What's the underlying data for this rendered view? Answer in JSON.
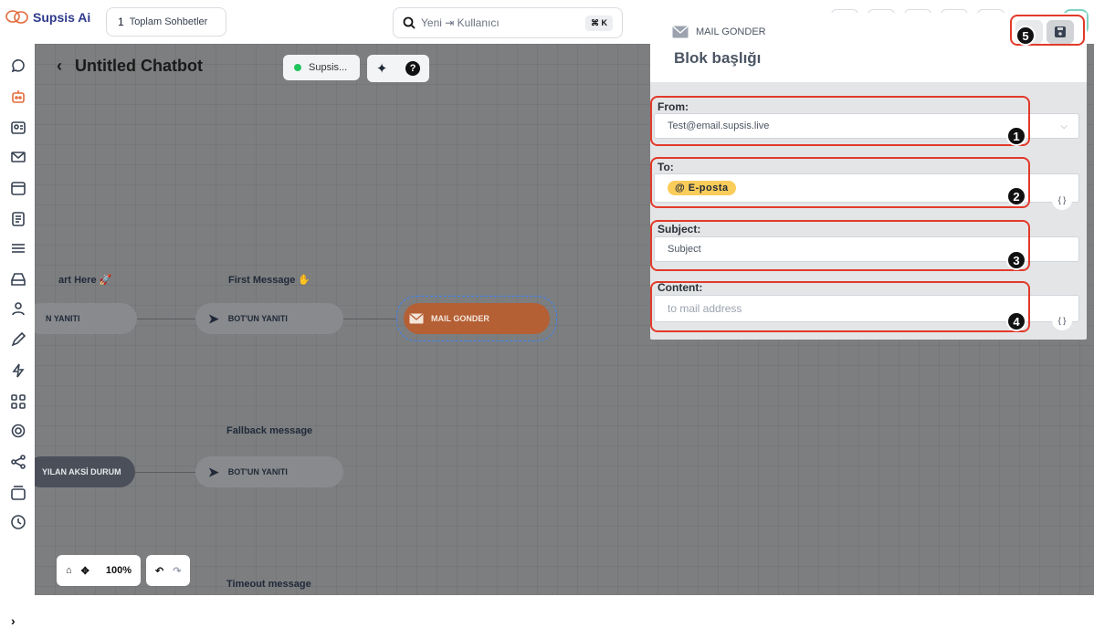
{
  "app": {
    "name": "Supsis Ai"
  },
  "topbar": {
    "total_count": "1",
    "total_label": "Toplam Sohbetler",
    "search_text": "Yeni ⇥ Kullanıcı",
    "shortcut": "⌘ K"
  },
  "canvas": {
    "chatbot_title": "Untitled Chatbot",
    "status_label": "Supsis...",
    "labels": {
      "start": "art Here 🚀",
      "first": "First Message ✋",
      "fallback": "Fallback message",
      "timeout": "Timeout message"
    },
    "nodes": {
      "start_node": "N YANITI",
      "bot_reply_1": "BOT'UN YANITI",
      "mail_send": "MAIL GONDER",
      "default_case": "YILAN AKSİ DURUM",
      "bot_reply_2": "BOT'UN YANITI"
    },
    "zoom": "100%"
  },
  "panel": {
    "type_label": "MAIL GONDER",
    "block_title": "Blok başlığı",
    "from": {
      "label": "From:",
      "value": "Test@email.supsis.live"
    },
    "to": {
      "label": "To:",
      "tag": "E-posta",
      "tag_symbol": "@"
    },
    "subject": {
      "label": "Subject:",
      "value": "Subject"
    },
    "content": {
      "label": "Content:",
      "placeholder": "to mail address"
    },
    "var_symbol": "{ }"
  },
  "annotations": [
    "1",
    "2",
    "3",
    "4",
    "5"
  ],
  "colors": {
    "accent": "#e36a3c",
    "highlight": "#e23a2a",
    "tag": "#facc5a",
    "status": "#22c55e"
  }
}
